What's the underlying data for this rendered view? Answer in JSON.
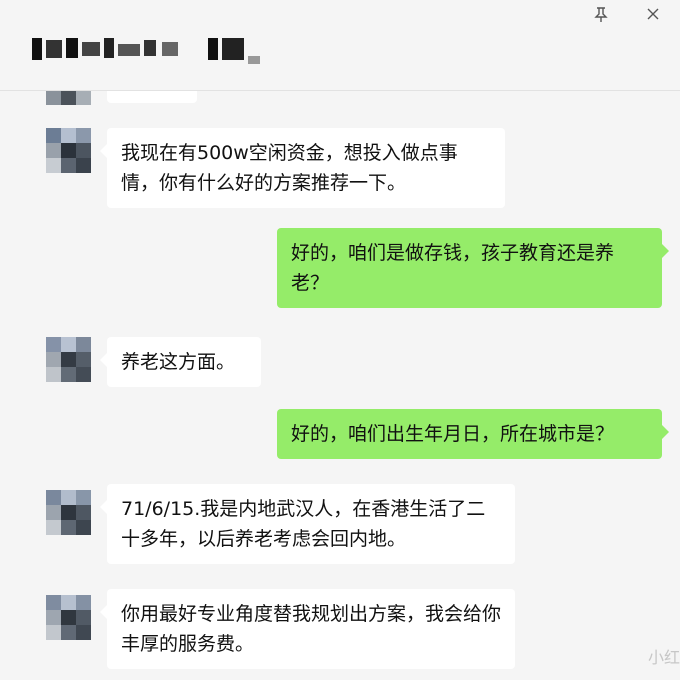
{
  "header": {
    "title_obscured": true,
    "pin_icon": "pin-icon",
    "close_icon": "close-icon"
  },
  "messages": [
    {
      "side": "incoming",
      "text": "我现在有500w空闲资金，想投入做点事情，你有什么好的方案推荐一下。"
    },
    {
      "side": "outgoing",
      "text": "好的，咱们是做存钱，孩子教育还是养老？"
    },
    {
      "side": "incoming",
      "text": "养老这方面。"
    },
    {
      "side": "outgoing",
      "text": "好的，咱们出生年月日，所在城市是？"
    },
    {
      "side": "incoming",
      "text": "71/6/15.我是内地武汉人，在香港生活了二十多年，以后养老考虑会回内地。"
    },
    {
      "side": "incoming",
      "text": "你用最好专业角度替我规划出方案，我会给你丰厚的服务费。"
    }
  ],
  "watermark": "小红",
  "colors": {
    "background": "#f5f5f5",
    "incoming_bubble": "#ffffff",
    "outgoing_bubble": "#95ec69"
  }
}
